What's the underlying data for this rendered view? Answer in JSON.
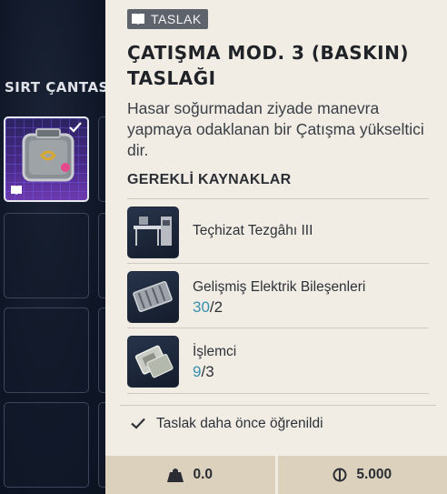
{
  "inventory": {
    "section_title": "SIRT ÇANTASI"
  },
  "tooltip": {
    "tag_label": "TASLAK",
    "title_line1": "ÇATIŞMA MOD. 3 (BASKIN)",
    "title_line2": "TASLAĞI",
    "description": "Hasar soğurmadan ziyade manevra yapmaya odaklanan bir Çatışma yükseltici dir.",
    "requirements_title": "GEREKLİ KAYNAKLAR",
    "requirements": [
      {
        "name": "Teçhizat Tezgâhı III",
        "have": "",
        "need": "",
        "icon": "workbench-icon"
      },
      {
        "name": "Gelişmiş Elektrik Bileşenleri",
        "have": "30",
        "need": "2",
        "icon": "electrical-components-icon"
      },
      {
        "name": "İşlemci",
        "have": "9",
        "need": "3",
        "icon": "processor-icon"
      }
    ],
    "learned_text": "Taslak daha önce öğrenildi",
    "weight": "0.0",
    "price": "5.000"
  },
  "colors": {
    "panel_bg": "#f1ede5",
    "footer_bg": "#dcd1bd",
    "have_count": "#3a8fb0",
    "tag_bg": "#5f646c",
    "selected_slot": "#4a2a8a"
  }
}
